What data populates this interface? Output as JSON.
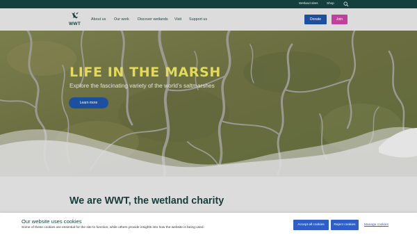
{
  "utility_bar": {
    "wetland_sites": "Wetland sites",
    "shop": "Shop",
    "search_icon": "search-icon"
  },
  "header": {
    "logo_text": "WWT",
    "nav": [
      "About us",
      "Our work",
      "Discover wetlands",
      "Visit",
      "Support us"
    ],
    "donate": "Donate",
    "join": "Join"
  },
  "hero": {
    "title": "LIFE IN THE MARSH",
    "subtitle": "Explore the fascinating variety of the world’s saltmarshes",
    "cta": "Learn more"
  },
  "main": {
    "heading": "We are WWT, the wetland charity"
  },
  "cookie_banner": {
    "title": "Our website uses cookies",
    "text": "Some of these cookies are essential for the site to function, while others provide insights into how the website is being used.",
    "accept": "Accept all cookies",
    "reject": "Reject cookies",
    "manage": "Manage cookies"
  },
  "colors": {
    "dark_green": "#153f3c",
    "blue": "#1d4f9f",
    "pink": "#c23f9e",
    "hero_title": "#e3da59",
    "page_bg": "#dcdcdc"
  }
}
